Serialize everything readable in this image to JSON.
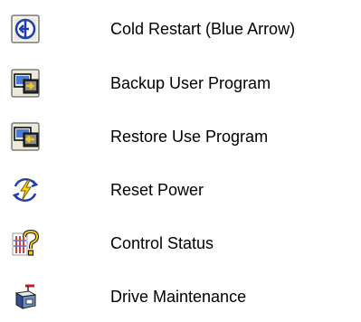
{
  "legend": {
    "items": [
      {
        "icon": "cold-restart-icon",
        "label": "Cold Restart (Blue Arrow)"
      },
      {
        "icon": "backup-user-program-icon",
        "label": "Backup User Program"
      },
      {
        "icon": "restore-user-program-icon",
        "label": "Restore Use Program"
      },
      {
        "icon": "reset-power-icon",
        "label": "Reset Power"
      },
      {
        "icon": "control-status-icon",
        "label": "Control Status"
      },
      {
        "icon": "drive-maintenance-icon",
        "label": "Drive Maintenance"
      }
    ]
  },
  "colors": {
    "background": "#ffffff",
    "text": "#000000",
    "toolbar_button": "#ece9d8",
    "arrow_blue": "#1f3fb0",
    "arrow_yellow": "#f2c81c",
    "lightning": "#ffd200"
  }
}
